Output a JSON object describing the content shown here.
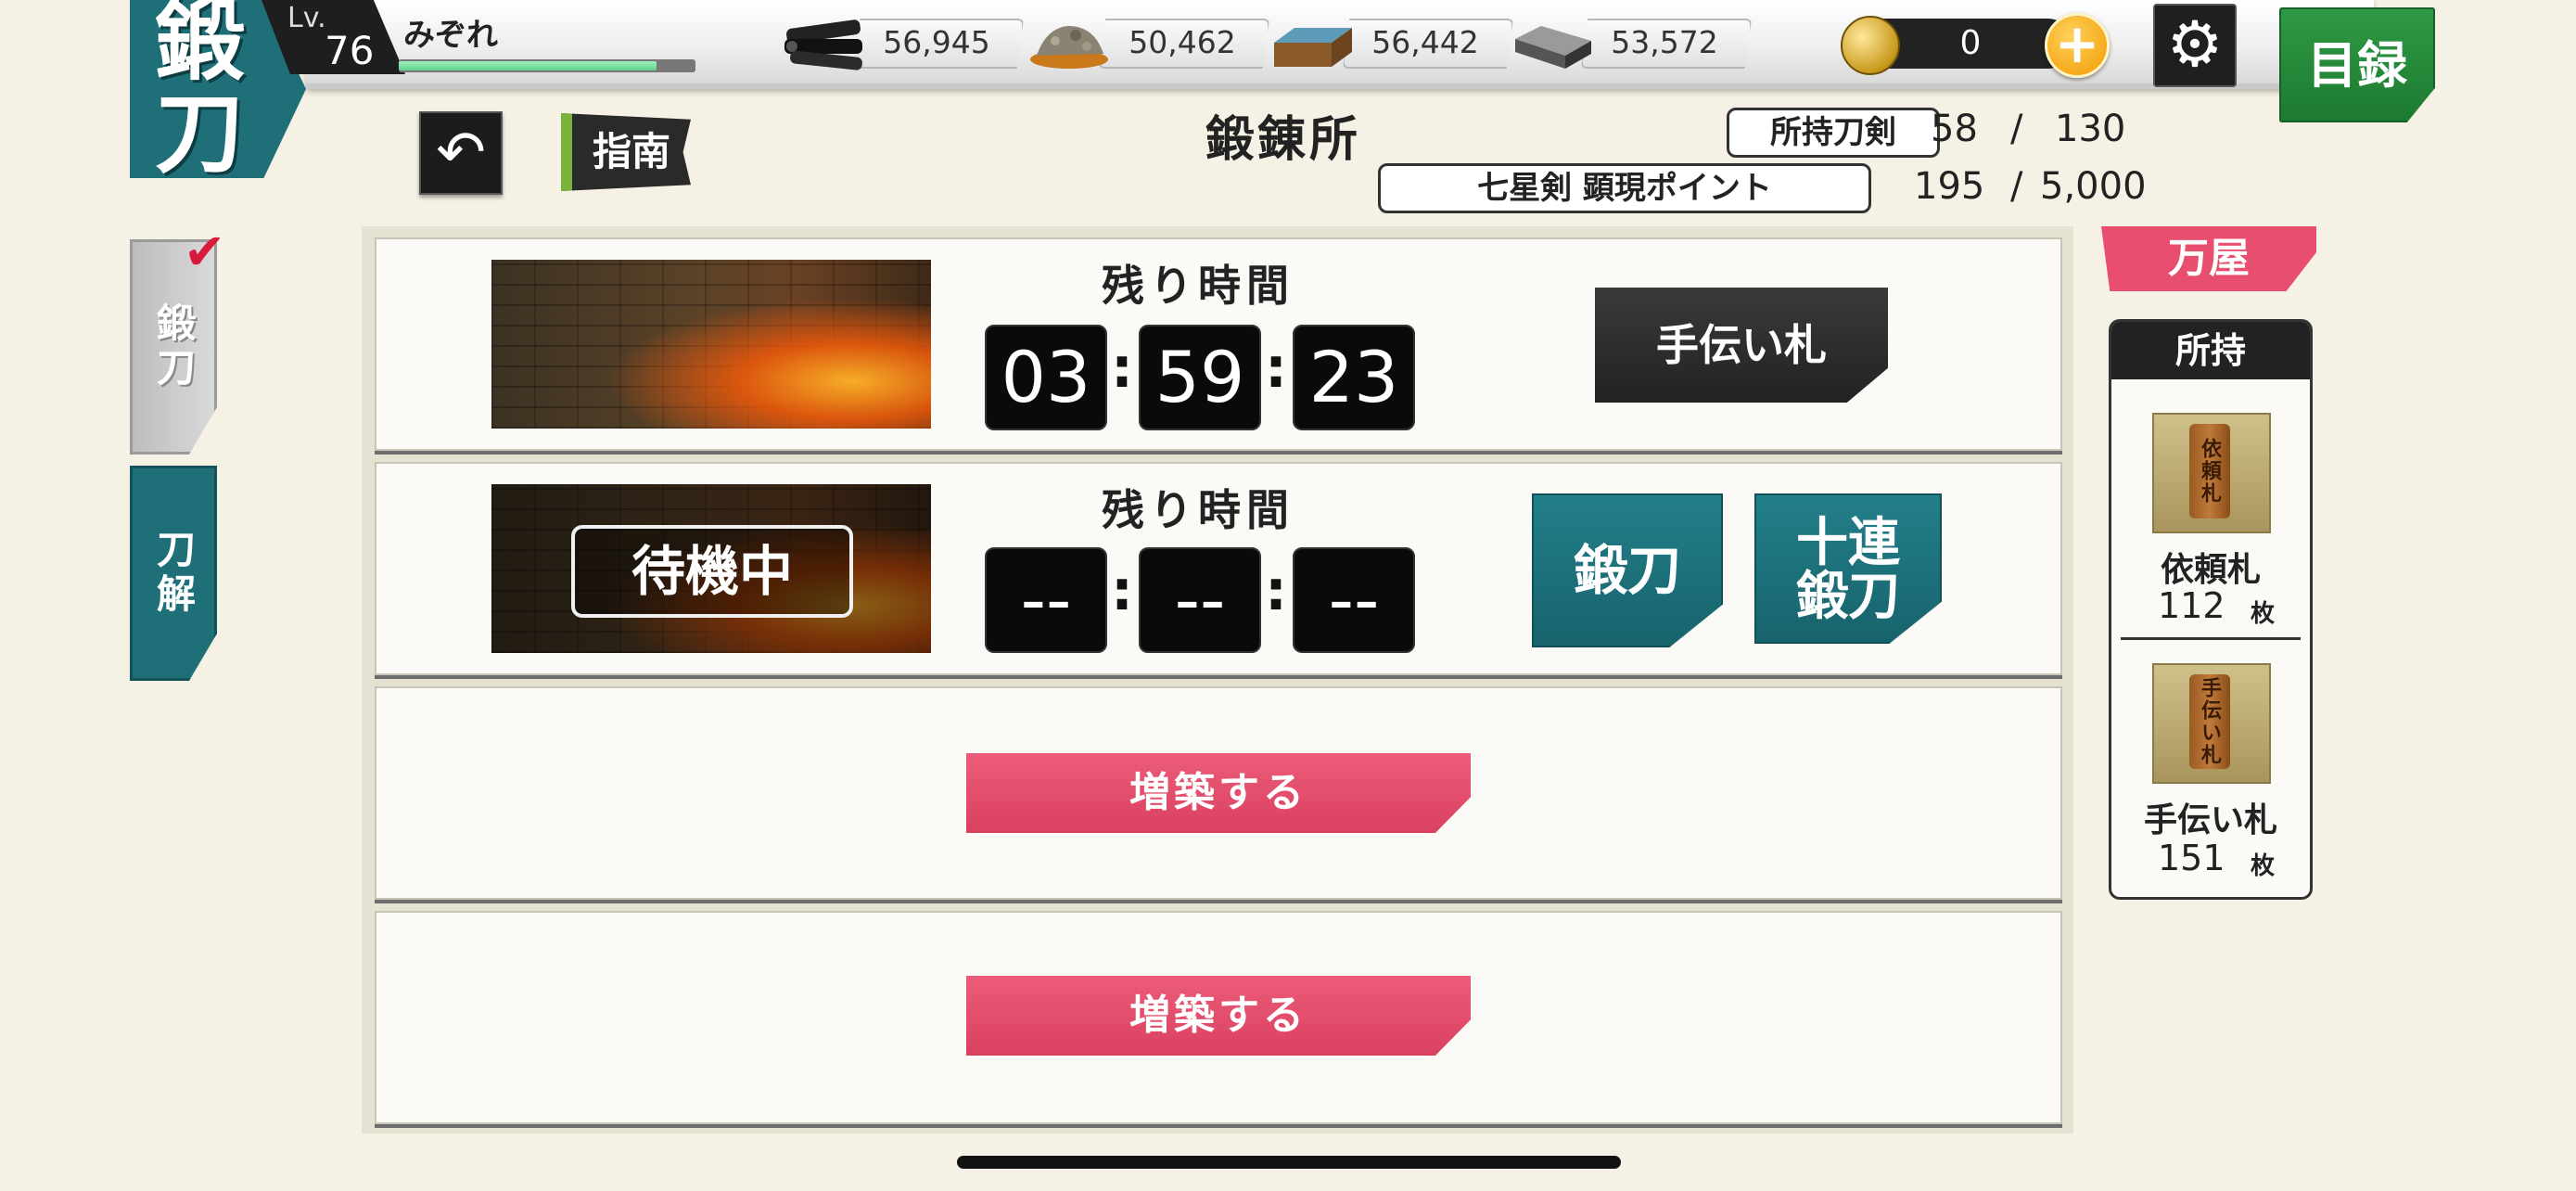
{
  "header": {
    "mode_badge": "鍛刀",
    "level_label": "Lv.",
    "level": "76",
    "player_name": "みぞれ",
    "xp_progress": 0.88,
    "resources": [
      {
        "icon": "charcoal-icon",
        "value": "56,945"
      },
      {
        "icon": "tamahagane-icon",
        "value": "50,462"
      },
      {
        "icon": "cooling-material-icon",
        "value": "56,442"
      },
      {
        "icon": "whetstone-icon",
        "value": "53,572"
      }
    ],
    "coins": "0",
    "add_coin_symbol": "+",
    "settings_symbol": "⚙",
    "catalog_label": "目録"
  },
  "nav": {
    "back_symbol": "↶",
    "guide_label": "指南"
  },
  "title": "鍛錬所",
  "stats": {
    "owned_label": "所持刀剣",
    "owned_current": "58",
    "owned_separator": "/",
    "owned_max": "130",
    "points_label": "七星剣 顕現ポイント",
    "points_current": "195",
    "points_separator": "/",
    "points_max": "5,000"
  },
  "side_tabs": {
    "forge": "鍛刀",
    "dismantle": "刀解",
    "check_symbol": "✔"
  },
  "slots": [
    {
      "remaining_label": "残り時間",
      "timer": [
        "03",
        "59",
        "23"
      ],
      "colon": ":",
      "help_button": "手伝い札"
    },
    {
      "status": "待機中",
      "remaining_label": "残り時間",
      "timer": [
        "--",
        "--",
        "--"
      ],
      "colon": ":",
      "forge_button": "鍛刀",
      "forge10_line1": "十連",
      "forge10_line2": "鍛刀"
    },
    {
      "expand_button": "増築する"
    },
    {
      "expand_button": "増築する"
    }
  ],
  "shop": {
    "tab_label": "万屋",
    "inventory_title": "所持",
    "items": [
      {
        "ticket_text": "依頼札",
        "name": "依頼札",
        "count": "112",
        "unit": "枚"
      },
      {
        "ticket_text": "手伝い札",
        "name": "手伝い札",
        "count": "151",
        "unit": "枚"
      }
    ]
  },
  "colors": {
    "teal": "#1f6f79",
    "pink": "#e84f6e",
    "green": "#2f9a44",
    "background": "#f5f1e4"
  }
}
